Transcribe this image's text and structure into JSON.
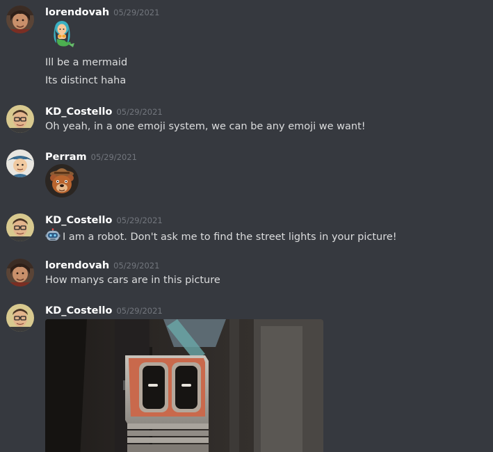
{
  "messages": [
    {
      "author": "lorendovah",
      "timestamp": "05/29/2021",
      "emoji": "mermaid-emoji",
      "lines": [
        "Ill be a mermaid",
        "Its distinct haha"
      ]
    },
    {
      "author": "KD_Costello",
      "timestamp": "05/29/2021",
      "lines": [
        "Oh yeah, in a one emoji system, we can be any emoji we want!"
      ]
    },
    {
      "author": "Perram",
      "timestamp": "05/29/2021",
      "emoji": "bear-cowboy-emoji"
    },
    {
      "author": "KD_Costello",
      "timestamp": "05/29/2021",
      "inline_emoji": "robot-emoji",
      "lines": [
        "I am a robot. Don't ask me to find the street lights in your picture!"
      ]
    },
    {
      "author": "lorendovah",
      "timestamp": "05/29/2021",
      "lines": [
        "How manys cars are in this picture"
      ]
    },
    {
      "author": "KD_Costello",
      "timestamp": "05/29/2021",
      "attachment": "robot-gif-image"
    }
  ],
  "colors": {
    "background": "#36393f",
    "username": "#ffffff",
    "timestamp": "#72767d",
    "text": "#dcddde"
  }
}
